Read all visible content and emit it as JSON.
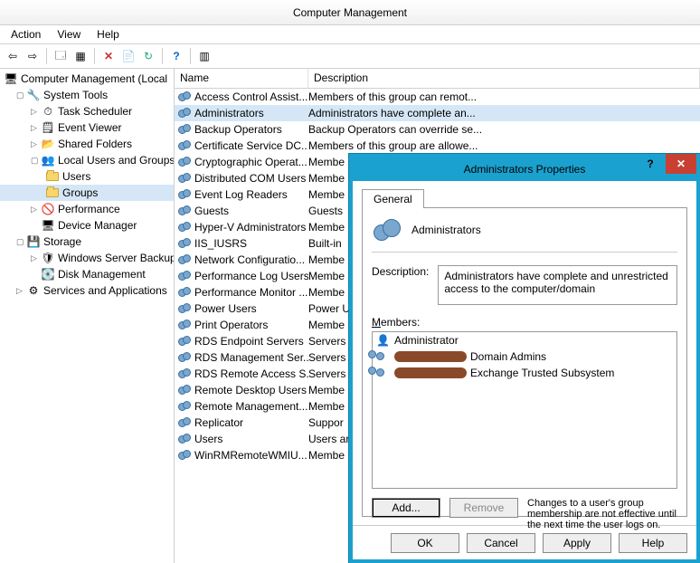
{
  "window": {
    "title": "Computer Management"
  },
  "menu": {
    "action": "Action",
    "view": "View",
    "help": "Help"
  },
  "tree": {
    "root": "Computer Management (Local",
    "system_tools": "System Tools",
    "items": [
      "Task Scheduler",
      "Event Viewer",
      "Shared Folders",
      "Local Users and Groups",
      "Performance",
      "Device Manager"
    ],
    "lug_users": "Users",
    "lug_groups": "Groups",
    "storage": "Storage",
    "storage_items": [
      "Windows Server Backup",
      "Disk Management"
    ],
    "services": "Services and Applications"
  },
  "list": {
    "col_name": "Name",
    "col_desc": "Description",
    "rows": [
      {
        "name": "Access Control Assist...",
        "desc": "Members of this group can remot..."
      },
      {
        "name": "Administrators",
        "desc": "Administrators have complete an..."
      },
      {
        "name": "Backup Operators",
        "desc": "Backup Operators can override se..."
      },
      {
        "name": "Certificate Service DC...",
        "desc": "Members of this group are allowe..."
      },
      {
        "name": "Cryptographic Operat...",
        "desc": "Membe"
      },
      {
        "name": "Distributed COM Users",
        "desc": "Membe"
      },
      {
        "name": "Event Log Readers",
        "desc": "Membe"
      },
      {
        "name": "Guests",
        "desc": "Guests"
      },
      {
        "name": "Hyper-V Administrators",
        "desc": "Membe"
      },
      {
        "name": "IIS_IUSRS",
        "desc": "Built-in"
      },
      {
        "name": "Network Configuratio...",
        "desc": "Membe"
      },
      {
        "name": "Performance Log Users",
        "desc": "Membe"
      },
      {
        "name": "Performance Monitor ...",
        "desc": "Membe"
      },
      {
        "name": "Power Users",
        "desc": "Power U"
      },
      {
        "name": "Print Operators",
        "desc": "Membe"
      },
      {
        "name": "RDS Endpoint Servers",
        "desc": "Servers"
      },
      {
        "name": "RDS Management Ser...",
        "desc": "Servers"
      },
      {
        "name": "RDS Remote Access S...",
        "desc": "Servers"
      },
      {
        "name": "Remote Desktop Users",
        "desc": "Membe"
      },
      {
        "name": "Remote Management...",
        "desc": "Membe"
      },
      {
        "name": "Replicator",
        "desc": "Suppor"
      },
      {
        "name": "Users",
        "desc": "Users ar"
      },
      {
        "name": "WinRMRemoteWMIU...",
        "desc": "Membe"
      }
    ]
  },
  "dialog": {
    "title": "Administrators Properties",
    "tab_general": "General",
    "group_name": "Administrators",
    "desc_label": "Description:",
    "description": "Administrators have complete and unrestricted access to the computer/domain",
    "members_label": "Members:",
    "members": [
      {
        "name": "Administrator",
        "redacted": false,
        "icon": "user"
      },
      {
        "name": "Domain Admins",
        "redacted": true,
        "icon": "group"
      },
      {
        "name": "Exchange Trusted Subsystem",
        "redacted": true,
        "icon": "group"
      }
    ],
    "add_label": "Add...",
    "remove_label": "Remove",
    "note": "Changes to a user's group membership are not effective until the next time the user logs on.",
    "ok": "OK",
    "cancel": "Cancel",
    "apply": "Apply",
    "help": "Help"
  }
}
